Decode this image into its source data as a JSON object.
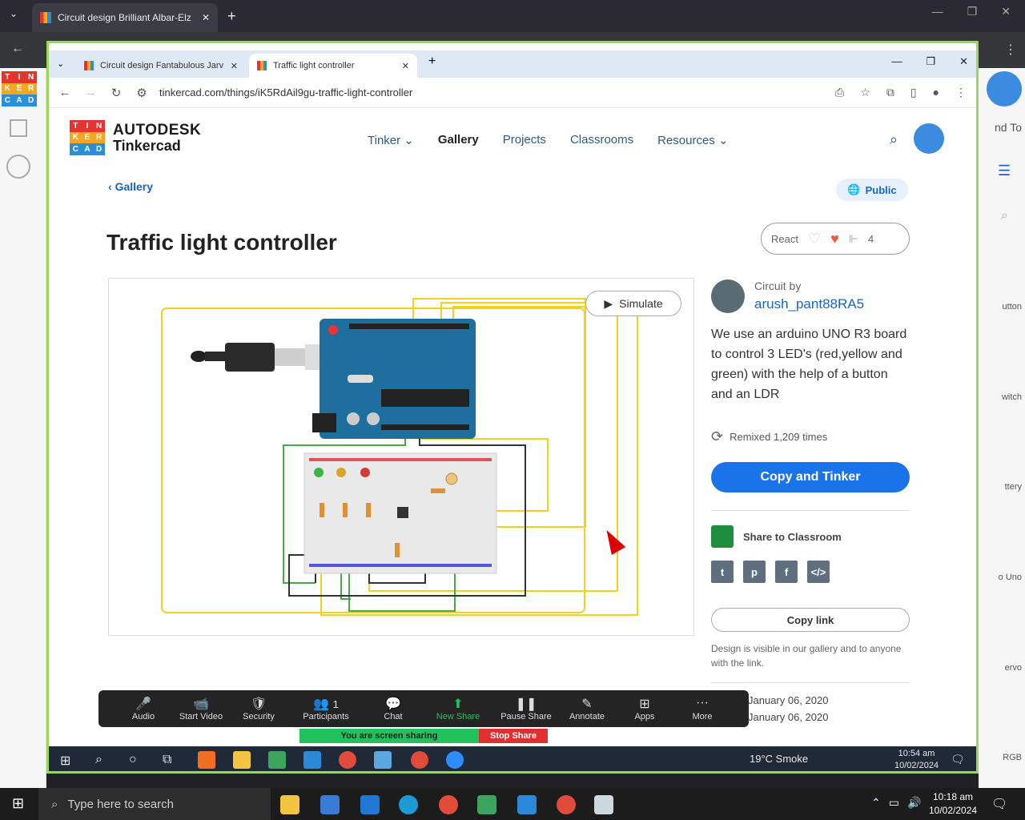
{
  "outer_browser": {
    "tab_title": "Circuit design Brilliant Albar-Elz",
    "new_tab": "+",
    "side_labels": [
      "nd To",
      "utton",
      "witch",
      "ttery",
      "o Uno",
      "ervo",
      "RGB"
    ]
  },
  "inner_browser": {
    "tabs": [
      {
        "title": "Circuit design Fantabulous Jarv"
      },
      {
        "title": "Traffic light controller"
      }
    ],
    "new_tab": "+",
    "url": "tinkercad.com/things/iK5RdAil9gu-traffic-light-controller"
  },
  "logo_letters": [
    "T",
    "I",
    "N",
    "K",
    "E",
    "R",
    "C",
    "A",
    "D"
  ],
  "logo_colors": [
    "#e3342f",
    "#e3342f",
    "#e3342f",
    "#f5a623",
    "#f5a623",
    "#f5a623",
    "#2b8fd6",
    "#2b8fd6",
    "#2b8fd6"
  ],
  "header": {
    "brand_top": "AUTODESK",
    "brand_bottom": "Tinkercad",
    "nav": [
      "Tinker",
      "Gallery",
      "Projects",
      "Classrooms",
      "Resources"
    ],
    "nav_current": "Gallery"
  },
  "page": {
    "back_label": "Gallery",
    "visibility": "Public",
    "title": "Traffic light controller",
    "react_label": "React",
    "react_count": "4",
    "simulate_label": "Simulate"
  },
  "sidebar": {
    "author_label": "Circuit by",
    "author_name": "arush_pant88RA5",
    "description": "We use an arduino UNO R3 board to control 3 LED's (red,yellow and green) with the help of a button and an LDR",
    "remixed": "Remixed 1,209 times",
    "copy_tinker": "Copy and Tinker",
    "classroom": "Share to Classroom",
    "copy_link": "Copy link",
    "visibility_note": "Design is visible in our gallery and to anyone with the link.",
    "dates": [
      "January 06, 2020",
      "January 06, 2020"
    ]
  },
  "zoom": {
    "buttons": [
      "Audio",
      "Start Video",
      "Security",
      "Participants",
      "Chat",
      "New Share",
      "Pause Share",
      "Annotate",
      "Apps",
      "More"
    ],
    "participants_count": "1",
    "sharing_label": "You are screen sharing",
    "stop_share": "Stop Share"
  },
  "inner_taskbar": {
    "weather": "19°C  Smoke",
    "time": "10:54 am",
    "date": "10/02/2024"
  },
  "taskbar": {
    "search_placeholder": "Type here to search",
    "time": "10:18 am",
    "date": "10/02/2024"
  }
}
